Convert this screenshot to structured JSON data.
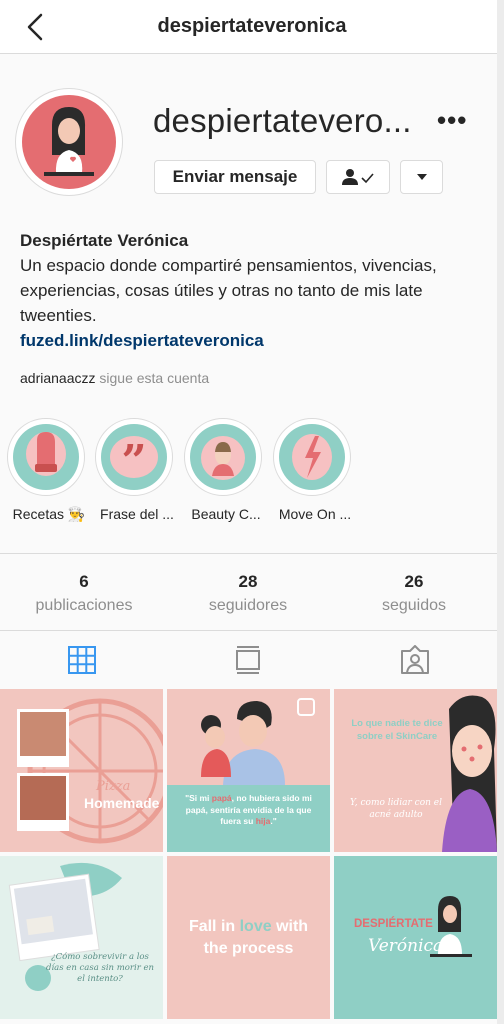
{
  "header": {
    "title": "despiertateveronica",
    "back_icon": "chevron-left-icon"
  },
  "profile": {
    "username": "despiertatevero...",
    "message_button": "Enviar mensaje",
    "follow_icon": "person-check-icon",
    "dropdown_icon": "caret-down-icon",
    "more_icon": "more-icon"
  },
  "bio": {
    "name": "Despiértate Verónica",
    "text": "Un espacio donde compartiré pensamientos, vivencias, experiencias, cosas útiles y otras no tanto de mis late tweenties.",
    "link": "fuzed.link/despiertateveronica"
  },
  "followed_by": {
    "user": "adrianaaczz",
    "text": "sigue esta cuenta"
  },
  "highlights": [
    {
      "label": "Recetas 👨‍🍳",
      "icon": "oven-mitt-icon"
    },
    {
      "label": "Frase del ...",
      "icon": "quote-icon"
    },
    {
      "label": "Beauty C...",
      "icon": "face-icon"
    },
    {
      "label": "Move On ...",
      "icon": "broken-heart-icon"
    }
  ],
  "stats": [
    {
      "value": "6",
      "label": "publicaciones"
    },
    {
      "value": "28",
      "label": "seguidores"
    },
    {
      "value": "26",
      "label": "seguidos"
    }
  ],
  "tabs": [
    {
      "icon": "grid-icon",
      "active": true
    },
    {
      "icon": "igtv-icon",
      "active": false
    },
    {
      "icon": "tagged-icon",
      "active": false
    }
  ],
  "posts": {
    "p1": {
      "line1": "Pizza",
      "line2": "Homemade"
    },
    "p2": {
      "quote_before": "\"Si mi ",
      "quote_bold1": "papá",
      "quote_mid": ", no hubiera sido mi papá, sentiría envidia de la que fuera su ",
      "quote_bold2": "hija",
      "quote_end": ".\""
    },
    "p3": {
      "title": "Lo que nadie te dice sobre el SkinCare",
      "script": "Y, como lidiar con el acné adulto"
    },
    "p4": {
      "script": "¿Cómo sobrevivir a los días en casa sin morir en el intento?"
    },
    "p5": {
      "pre": "Fall in ",
      "accent": "love",
      "post": " with the process"
    },
    "p6": {
      "title": "DESPIÉRTATE",
      "script": "Verónica"
    }
  },
  "colors": {
    "accent_teal": "#8fcfc5",
    "pink": "#f1c6be",
    "coral": "#e46d71",
    "link": "#00376b",
    "muted": "#8e8e8e",
    "tab_active": "#3897f0"
  }
}
